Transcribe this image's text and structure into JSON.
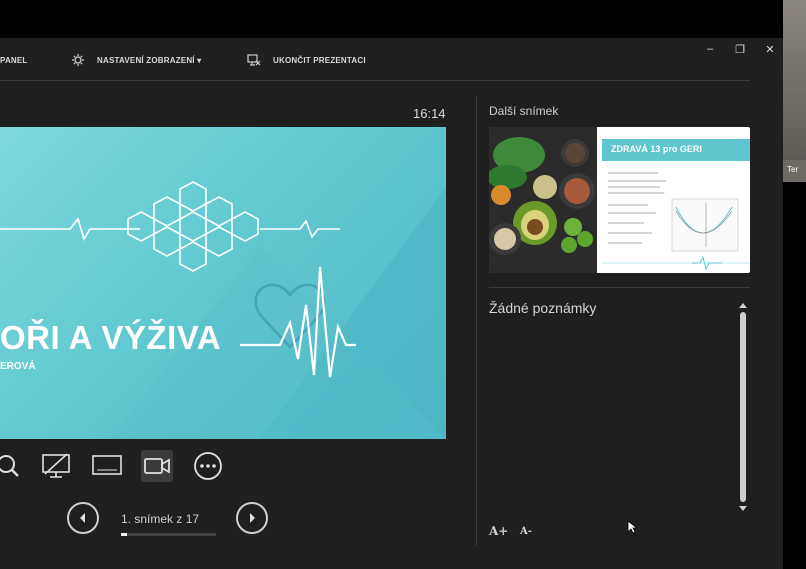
{
  "toolbar": {
    "items": [
      {
        "label": "PANEL",
        "icon": "panel-icon"
      },
      {
        "label": "NASTAVENÍ ZOBRAZENÍ ▾",
        "icon": "display-settings-icon"
      },
      {
        "label": "UKONČIT PREZENTACI",
        "icon": "end-show-icon"
      }
    ],
    "window_buttons": [
      "–",
      "❐",
      "✕"
    ]
  },
  "presenter": {
    "time": "16:14",
    "slide": {
      "title": "OŘI A VÝŽIVA",
      "subtitle": "EROVÁ"
    },
    "controls": [
      "zoom-icon",
      "black-screen-icon",
      "display-icon",
      "video-icon",
      "more-icon"
    ],
    "counter": "1. snímek z 17",
    "progress_fraction": 0.06
  },
  "next_slide": {
    "label": "Další snímek",
    "title": "ZDRAVÁ 13 pro GERI"
  },
  "notes": {
    "label": "Žádné poznámky",
    "increase_font": "A+",
    "decrease_font": "A-"
  },
  "camera": {
    "name": "Ter"
  },
  "colors": {
    "accent": "#5fc6cf",
    "background": "#1f1f1f"
  }
}
